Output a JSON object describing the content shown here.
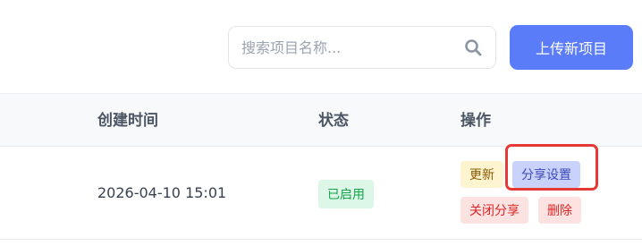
{
  "toolbar": {
    "search_placeholder": "搜索项目名称...",
    "upload_label": "上传新项目"
  },
  "table": {
    "headers": {
      "created_time": "创建时间",
      "status": "状态",
      "actions": "操作"
    },
    "rows": [
      {
        "created_time": "2026-04-10 15:01",
        "status": "已启用",
        "actions": {
          "update": "更新",
          "share_settings": "分享设置",
          "close_share": "关闭分享",
          "delete": "删除"
        }
      }
    ]
  },
  "colors": {
    "primary": "#5b7cf8",
    "status_enabled_bg": "#dcf7e7",
    "highlight": "#e53935"
  },
  "icons": {
    "search": "search-icon"
  }
}
